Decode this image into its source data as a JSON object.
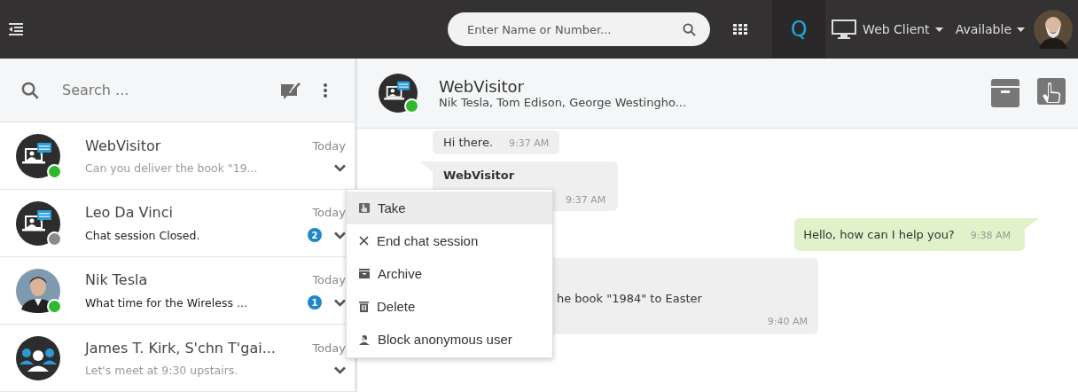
{
  "topbar": {
    "search": {
      "placeholder": "Enter Name or Number..."
    },
    "app_letter": "Q",
    "client": "Web Client",
    "presence": "Available"
  },
  "sidebar": {
    "search": {
      "placeholder": "Search ..."
    },
    "conversations": [
      {
        "name": "WebVisitor",
        "time": "Today",
        "preview": "Can you deliver the book \"19...",
        "kind": "visitor",
        "color": "#2eb82e"
      },
      {
        "name": "Leo Da Vinci",
        "time": "Today",
        "preview": "Chat session Closed.",
        "kind": "visitor",
        "color": "#8a8a8a",
        "unread": "2"
      },
      {
        "name": "Nik Tesla",
        "time": "Today",
        "preview": "What time for the Wireless ...",
        "kind": "person",
        "color": "#2eb82e",
        "unread": "1"
      },
      {
        "name": "James T. Kirk, S'chn T'gai...",
        "time": "Today",
        "preview": "Let's meet at 9:30 upstairs.",
        "kind": "group"
      }
    ]
  },
  "chat": {
    "title": "WebVisitor",
    "participants": "Nik Tesla, Tom Edison, George Westingho...",
    "color": "#2eb82e",
    "messages": [
      {
        "kind": "incoming",
        "text": "Hi there.",
        "time": "9:37 AM"
      },
      {
        "kind": "incoming",
        "sender": "WebVisitor",
        "time": "9:37 AM"
      },
      {
        "kind": "outgoing",
        "text": "Hello, how can I help you?",
        "time": "9:38 AM"
      },
      {
        "kind": "partial",
        "text": "he book \"1984\" to Easter",
        "time": "9:40 AM"
      }
    ]
  },
  "context_menu": [
    {
      "label": "Take",
      "selected": true
    },
    {
      "label": "End chat session",
      "selected": false
    },
    {
      "label": "Archive",
      "selected": false
    },
    {
      "label": "Delete",
      "selected": false
    },
    {
      "label": "Block anonymous user",
      "selected": false
    }
  ]
}
